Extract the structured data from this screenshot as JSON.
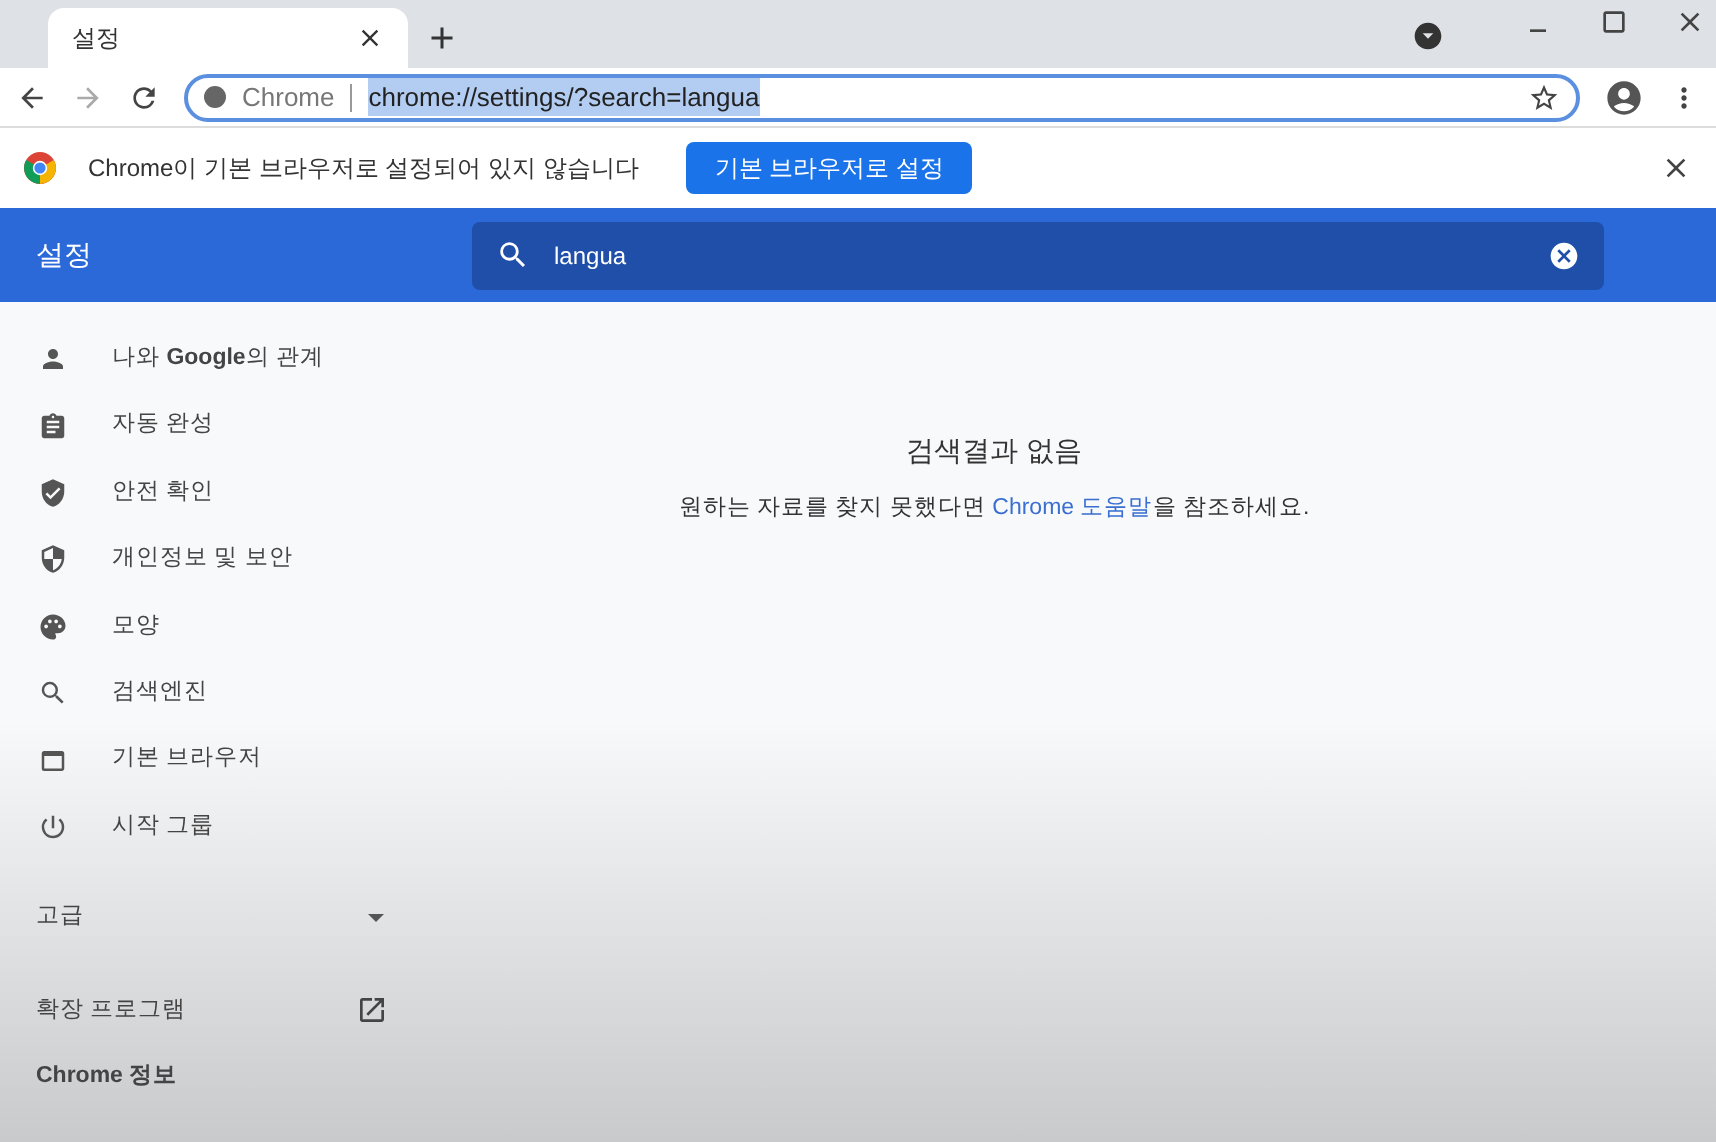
{
  "tabs": [
    {
      "title": "설정",
      "selected": true
    }
  ],
  "address_bar": {
    "scheme_label": "Chrome",
    "url": "chrome://settings/?search=langua",
    "selected": true
  },
  "infobar": {
    "message": "Chrome이 기본 브라우저로 설정되어 있지 않습니다",
    "button": "기본 브라우저로 설정"
  },
  "header": {
    "title": "설정",
    "search_value": "langua"
  },
  "sidebar": {
    "items": [
      {
        "label": "나와 **Google**의 관계"
      },
      {
        "label": "자동 완성"
      },
      {
        "label": "안전 확인"
      },
      {
        "label": "개인정보 및 보안"
      },
      {
        "label": "모양"
      },
      {
        "label": "검색엔진"
      },
      {
        "label": "기본 브라우저"
      },
      {
        "label": "시작 그룹"
      }
    ],
    "advanced": {
      "label": "고급",
      "expanded": false
    },
    "extensions": "확장 프로그램",
    "about": "Chrome 정보"
  },
  "results": {
    "title": "검색결과 없음",
    "before": "원하는 자료를 찾지 못했다면",
    "link": "Chrome 도움말",
    "after": "을 참조하세요."
  }
}
